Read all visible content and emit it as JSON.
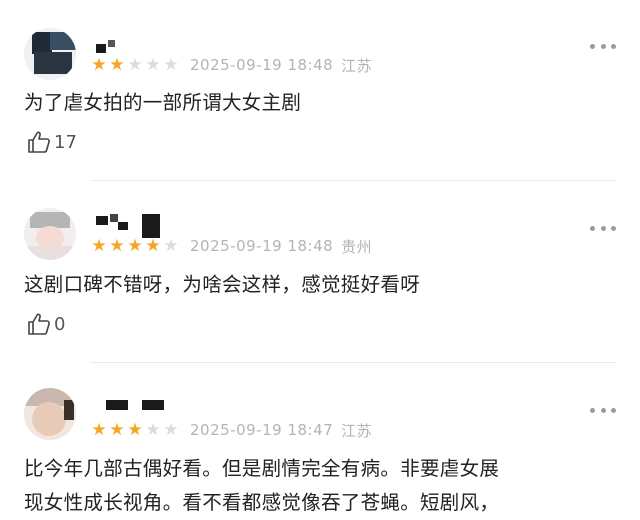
{
  "colors": {
    "star_on": "#f5a623",
    "star_off": "#dcdcdc",
    "meta": "#b4b4b4"
  },
  "comments": [
    {
      "rating": 2,
      "stars_total": 5,
      "date": "2025-09-19 18:48",
      "location": "江苏",
      "text": "为了虐女拍的一部所谓大女主剧",
      "likes": "17",
      "like_icon": "thumbs-up-icon",
      "more_icon": "more-dots-icon"
    },
    {
      "rating": 4,
      "stars_total": 5,
      "date": "2025-09-19 18:48",
      "location": "贵州",
      "text": "这剧口碑不错呀，为啥会这样，感觉挺好看呀",
      "likes": "0",
      "like_icon": "thumbs-up-icon",
      "more_icon": "more-dots-icon"
    },
    {
      "rating": 3,
      "stars_total": 5,
      "date": "2025-09-19 18:47",
      "location": "江苏",
      "text_lines": [
        "比今年几部古偶好看。但是剧情完全有病。非要虐女展",
        "现女性成长视角。看不看都感觉像吞了苍蝇。短剧风，"
      ],
      "more_icon": "more-dots-icon"
    }
  ]
}
